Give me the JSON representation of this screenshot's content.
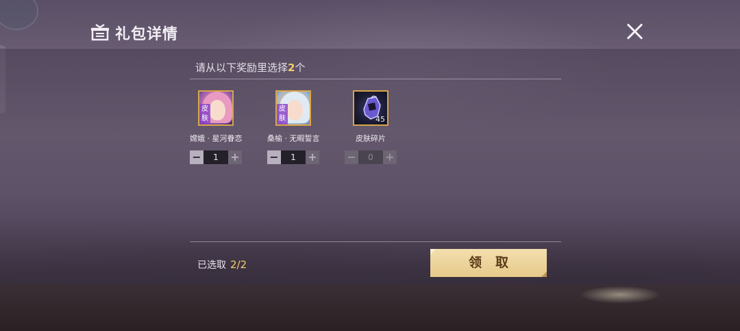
{
  "header": {
    "title": "礼包详情",
    "icon": "gift-box-icon",
    "close_icon": "close-icon"
  },
  "panel": {
    "instruction_prefix": "请从以下奖励里选择",
    "instruction_count": "2",
    "instruction_suffix": "个",
    "rewards": [
      {
        "name": "嫦娥 · 星河眷恋",
        "badge": "皮肤",
        "qty": "1",
        "minus": "−",
        "plus": "+"
      },
      {
        "name": "桑榆 · 无暇誓言",
        "badge": "皮肤",
        "qty": "1",
        "minus": "−",
        "plus": "+"
      },
      {
        "name": "皮肤碎片",
        "count": "45",
        "qty": "0",
        "minus": "−",
        "plus": "+"
      }
    ],
    "selected_label": "已选取",
    "selected_value": "2/2",
    "claim_label": "领取"
  },
  "colors": {
    "accent": "#f4cf6a",
    "claim_button": "#e7c98a",
    "frame": "#d9a54a"
  }
}
